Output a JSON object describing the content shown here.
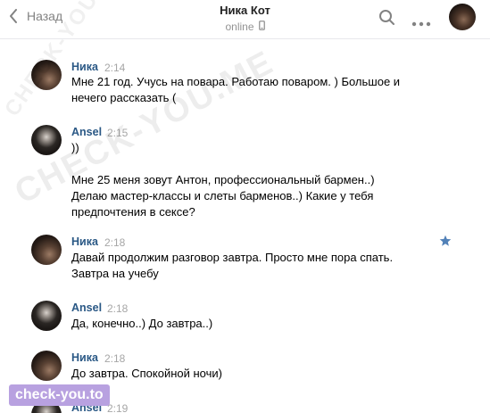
{
  "header": {
    "back_label": "Назад",
    "title": "Ника Кот",
    "status": "online"
  },
  "messages": [
    {
      "author": "Ника",
      "time": "2:14",
      "text": "Мне 21 год. Учусь на повара. Работаю поваром. ) Большое и\nнечего рассказать ("
    },
    {
      "author": "Ansel",
      "time": "2:15",
      "text": "))\n\nМне 25 меня зовут Антон, профессиональный бармен..)\nДелаю мастер-классы и слеты барменов..) Какие у тебя\nпредпочтения в сексе?"
    },
    {
      "author": "Ника",
      "time": "2:18",
      "text": "Давай продолжим разговор завтра. Просто мне пора спать.\nЗавтра на учебу"
    },
    {
      "author": "Ansel",
      "time": "2:18",
      "text": "Да, конечно..) До завтра..)"
    },
    {
      "author": "Ника",
      "time": "2:18",
      "text": "До завтра. Спокойной ночи)"
    },
    {
      "author": "Ansel",
      "time": "2:19",
      "text": ""
    }
  ],
  "watermark": {
    "text": "CHECK-YOU.ME",
    "text_small": "CHECK-YOU.ME"
  },
  "badge": {
    "text": "check-you.to"
  },
  "colors": {
    "author": "#2a5885",
    "badge": "#b8a1e0",
    "star": "#5181b8"
  }
}
